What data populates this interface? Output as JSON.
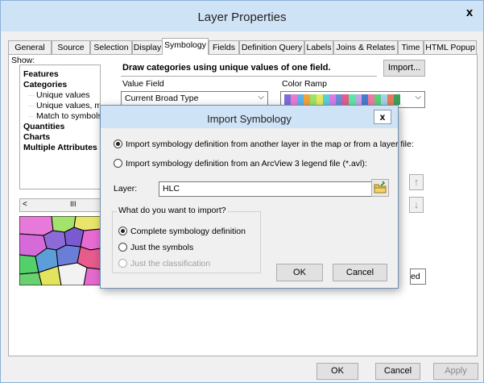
{
  "window": {
    "title": "Layer Properties",
    "close_label": "x"
  },
  "tabs": [
    {
      "label": "General"
    },
    {
      "label": "Source"
    },
    {
      "label": "Selection"
    },
    {
      "label": "Display"
    },
    {
      "label": "Symbology",
      "active": true
    },
    {
      "label": "Fields"
    },
    {
      "label": "Definition Query"
    },
    {
      "label": "Labels"
    },
    {
      "label": "Joins & Relates"
    },
    {
      "label": "Time"
    },
    {
      "label": "HTML Popup"
    }
  ],
  "show": {
    "label": "Show:",
    "items": [
      {
        "label": "Features",
        "bold": true
      },
      {
        "label": "Categories",
        "bold": true
      },
      {
        "label": "Unique values",
        "sub": true
      },
      {
        "label": "Unique values, ma",
        "sub": true
      },
      {
        "label": "Match to symbols",
        "sub": true
      },
      {
        "label": "Quantities",
        "bold": true
      },
      {
        "label": "Charts",
        "bold": true
      },
      {
        "label": "Multiple Attributes",
        "bold": true
      }
    ],
    "scroll_left": "<",
    "scroll_thumb": "III"
  },
  "symbology": {
    "description": "Draw categories using unique values of one field.",
    "import_label": "Import...",
    "value_field_label": "Value Field",
    "value_field_value": "Current Broad Type",
    "color_ramp_label": "Color Ramp",
    "color_ramp_colors": [
      "#7c6cd8",
      "#e87bcf",
      "#5ab4e8",
      "#f2a33a",
      "#9be36b",
      "#e8e85a",
      "#5acfd8",
      "#d87ae8",
      "#6a8ad8",
      "#e85a8a",
      "#5ae8a4",
      "#c8a4e8",
      "#4a7ad0",
      "#f07aa0",
      "#5ad07a",
      "#a4d0e8",
      "#e87a5a",
      "#3aa05a"
    ],
    "move_up_icon": "↑",
    "move_down_icon": "↓",
    "partial_dropdown_value": "ed"
  },
  "dialog": {
    "title": "Import Symbology",
    "close_label": "x",
    "option_layer_label": "Import symbology definition from another layer in the map or from a layer file:",
    "option_avl_label": "Import symbology definition from an ArcView 3 legend file (*.avl):",
    "layer_field_label": "Layer:",
    "layer_value": "HLC",
    "group_label": "What do you want to import?",
    "import_options": [
      {
        "label": "Complete symbology definition",
        "checked": true,
        "disabled": false
      },
      {
        "label": "Just the symbols",
        "checked": false,
        "disabled": false
      },
      {
        "label": "Just the classification",
        "checked": false,
        "disabled": true
      }
    ],
    "ok_label": "OK",
    "cancel_label": "Cancel"
  },
  "footer": {
    "ok_label": "OK",
    "cancel_label": "Cancel",
    "apply_label": "Apply"
  }
}
